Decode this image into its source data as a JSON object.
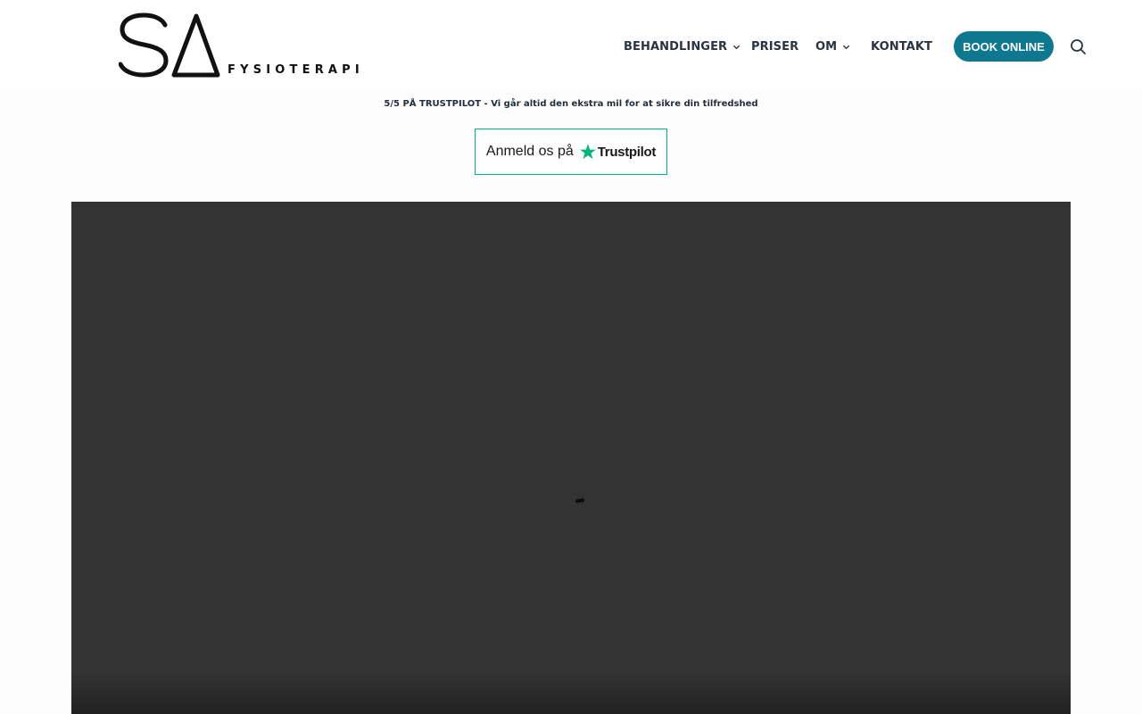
{
  "header": {
    "logo": {
      "mark": "SA",
      "subtitle": "FYSIOTERAPI"
    },
    "nav": [
      {
        "label": "BEHANDLINGER",
        "has_dropdown": true
      },
      {
        "label": "PRISER",
        "has_dropdown": false
      },
      {
        "label": "OM",
        "has_dropdown": true
      },
      {
        "label": "KONTAKT",
        "has_dropdown": false
      }
    ],
    "book_button": "BOOK ONLINE",
    "search_icon": "search-icon",
    "accent_color": "#0e7891"
  },
  "trust": {
    "tagline": "5/5 PÅ TRUSTPILOT - Vi går altid den ekstra mil for at sikre din tilfredshed",
    "review_prefix": "Anmeld os på",
    "brand": "Trustpilot",
    "brand_color": "#00b67a"
  },
  "video": {
    "state": "loading",
    "background": "#333333"
  }
}
